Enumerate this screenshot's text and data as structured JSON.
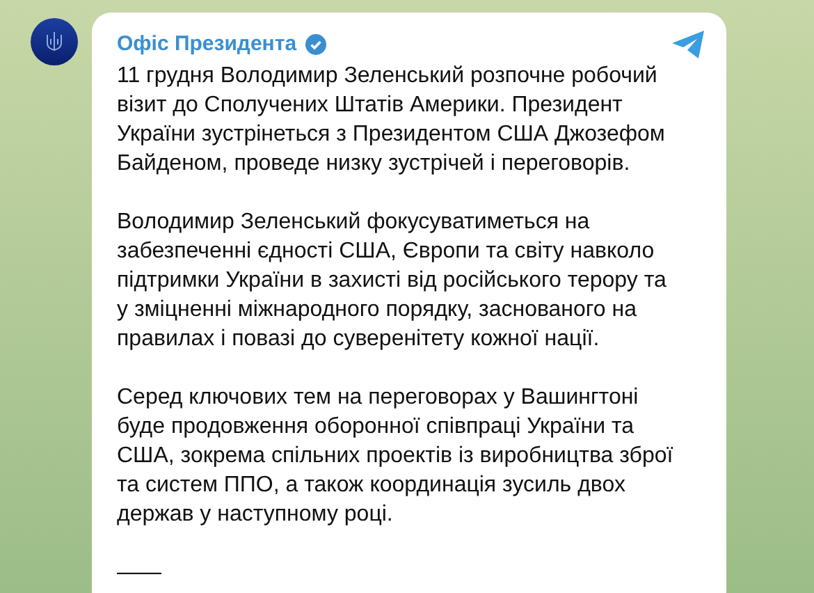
{
  "post": {
    "channel": "Офіс Президента",
    "verified": true,
    "paragraphs": [
      "11 грудня Володимир Зеленський розпочне робочий візит до Сполучених Штатів Америки. Президент України зустрінеться з Президентом США Джозефом Байденом, проведе низку зустрічей і переговорів.",
      "Володимир Зеленський фокусуватиметься на забезпеченні єдності США, Європи та світу навколо підтримки України в захисті від російського терору та у зміцненні міжнародного порядку, заснованого на правилах і повазі до суверенітету кожної нації.",
      "Серед ключових тем на переговорах у Вашингтоні буде продовження оборонної співпраці України та США, зокрема спільних проектів із виробництва зброї та систем ППО, а також координація зусиль двох держав у наступному році.",
      "——"
    ]
  }
}
